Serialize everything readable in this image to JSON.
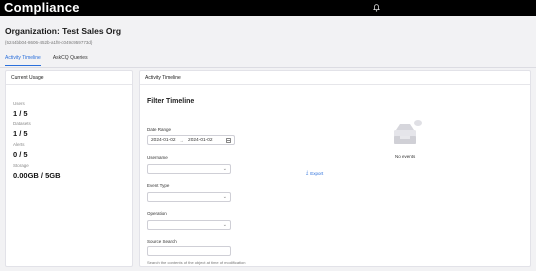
{
  "header": {
    "title": "Compliance",
    "icon": "notification-bell-icon"
  },
  "org": {
    "title": "Organization: Test Sales Org",
    "id": "{5244bb04-8606-452b-a1f8-c049c959773d}"
  },
  "tabs": [
    {
      "label": "Activity Timeline",
      "active": true
    },
    {
      "label": "AskCQ Queries",
      "active": false
    }
  ],
  "usage": {
    "header": "Current Usage",
    "items": [
      {
        "label": "Users",
        "value": "1 / 5"
      },
      {
        "label": "Datasets",
        "value": "1 / 5"
      },
      {
        "label": "Alerts",
        "value": "0 / 5"
      },
      {
        "label": "Storage",
        "value": "0.00GB / 5GB"
      }
    ]
  },
  "timeline": {
    "header": "Activity Timeline",
    "filter_title": "Filter Timeline",
    "date_range": {
      "label": "Date Range",
      "start": "2024-01-02",
      "arrow": "→",
      "end": "2024-01-02"
    },
    "username_label": "Username",
    "event_type_label": "Event Type",
    "operation_label": "Operation",
    "source_search_label": "Source Search",
    "source_search_help": "Search the contents of the object at time of modification",
    "export_label": "Export",
    "no_events": "No events"
  },
  "colors": {
    "accent": "#2a6fdb",
    "header_bg": "#000000",
    "page_bg": "#f2f2f4"
  }
}
